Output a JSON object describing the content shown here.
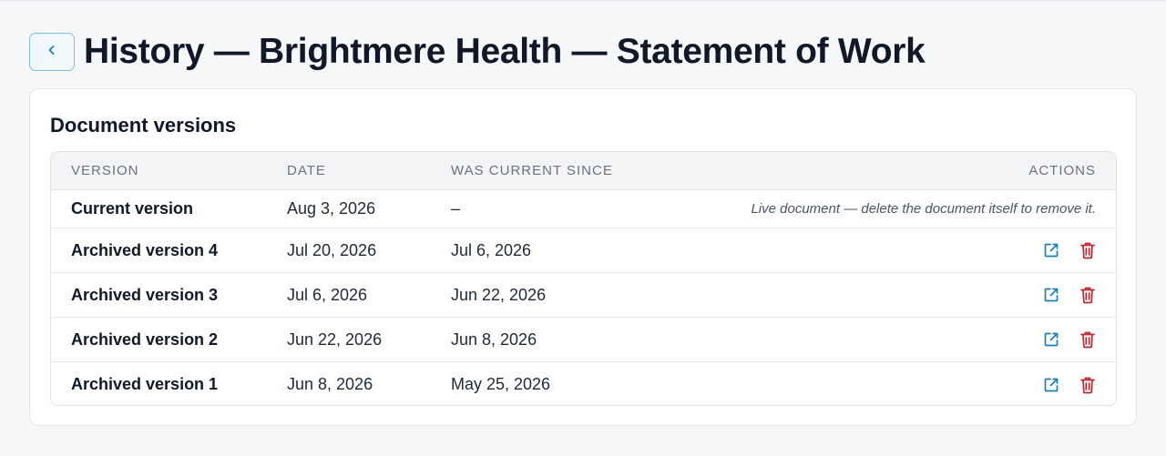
{
  "header": {
    "title": "History — Brightmere Health — Statement of Work",
    "back_icon": "chevron-left-icon"
  },
  "card": {
    "title": "Document versions"
  },
  "table": {
    "columns": {
      "version": "Version",
      "date": "Date",
      "since": "Was current since",
      "actions": "Actions"
    },
    "current": {
      "version": "Current version",
      "date": "Aug 3, 2026",
      "since": "–",
      "note": "Live document — delete the document itself to remove it."
    },
    "rows": [
      {
        "version": "Archived version 4",
        "date": "Jul 20, 2026",
        "since": "Jul 6, 2026"
      },
      {
        "version": "Archived version 3",
        "date": "Jul 6, 2026",
        "since": "Jun 22, 2026"
      },
      {
        "version": "Archived version 2",
        "date": "Jun 22, 2026",
        "since": "Jun 8, 2026"
      },
      {
        "version": "Archived version 1",
        "date": "Jun 8, 2026",
        "since": "May 25, 2026"
      }
    ],
    "action_icons": {
      "open": "external-link-icon",
      "delete": "trash-icon"
    }
  },
  "colors": {
    "accent": "#1a7fb5",
    "danger": "#c0262d",
    "back_border": "#7cc2dc"
  }
}
